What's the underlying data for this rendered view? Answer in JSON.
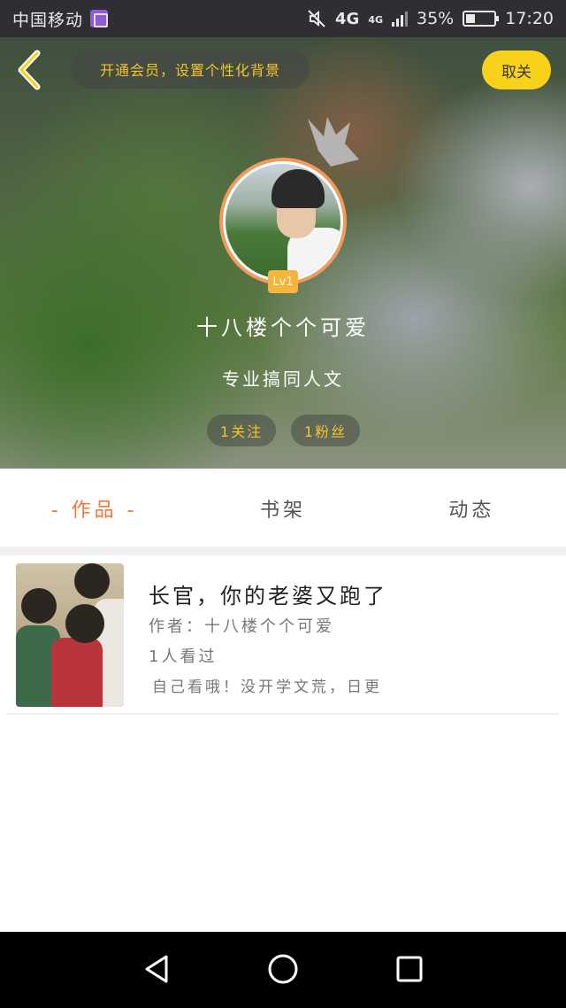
{
  "status_bar": {
    "carrier": "中国移动",
    "network": "4G",
    "network_small": "4G",
    "battery": "35%",
    "time": "17:20"
  },
  "header": {
    "vip_banner": "开通会员，设置个性化背景",
    "cancel_label": "取关"
  },
  "profile": {
    "level": "Lv1",
    "username": "十八楼个个可爱",
    "bio": "专业搞同人文",
    "follow_stat": "1关注",
    "fans_stat": "1粉丝"
  },
  "tabs": [
    {
      "label": "- 作品 -",
      "active": true
    },
    {
      "label": "书架",
      "active": false
    },
    {
      "label": "动态",
      "active": false
    }
  ],
  "works": [
    {
      "title": "长官，你的老婆又跑了",
      "author": "作者：十八楼个个可爱",
      "views": "1人看过",
      "description": "自己看哦！没开学文荒，日更"
    }
  ],
  "colors": {
    "accent": "#f07a3a",
    "yellow": "#f7d11a",
    "gold_text": "#f2c52a"
  },
  "icons": [
    "back-arrow-icon",
    "crown-icon",
    "nav-back-icon",
    "nav-home-icon",
    "nav-recent-icon",
    "mute-icon"
  ]
}
